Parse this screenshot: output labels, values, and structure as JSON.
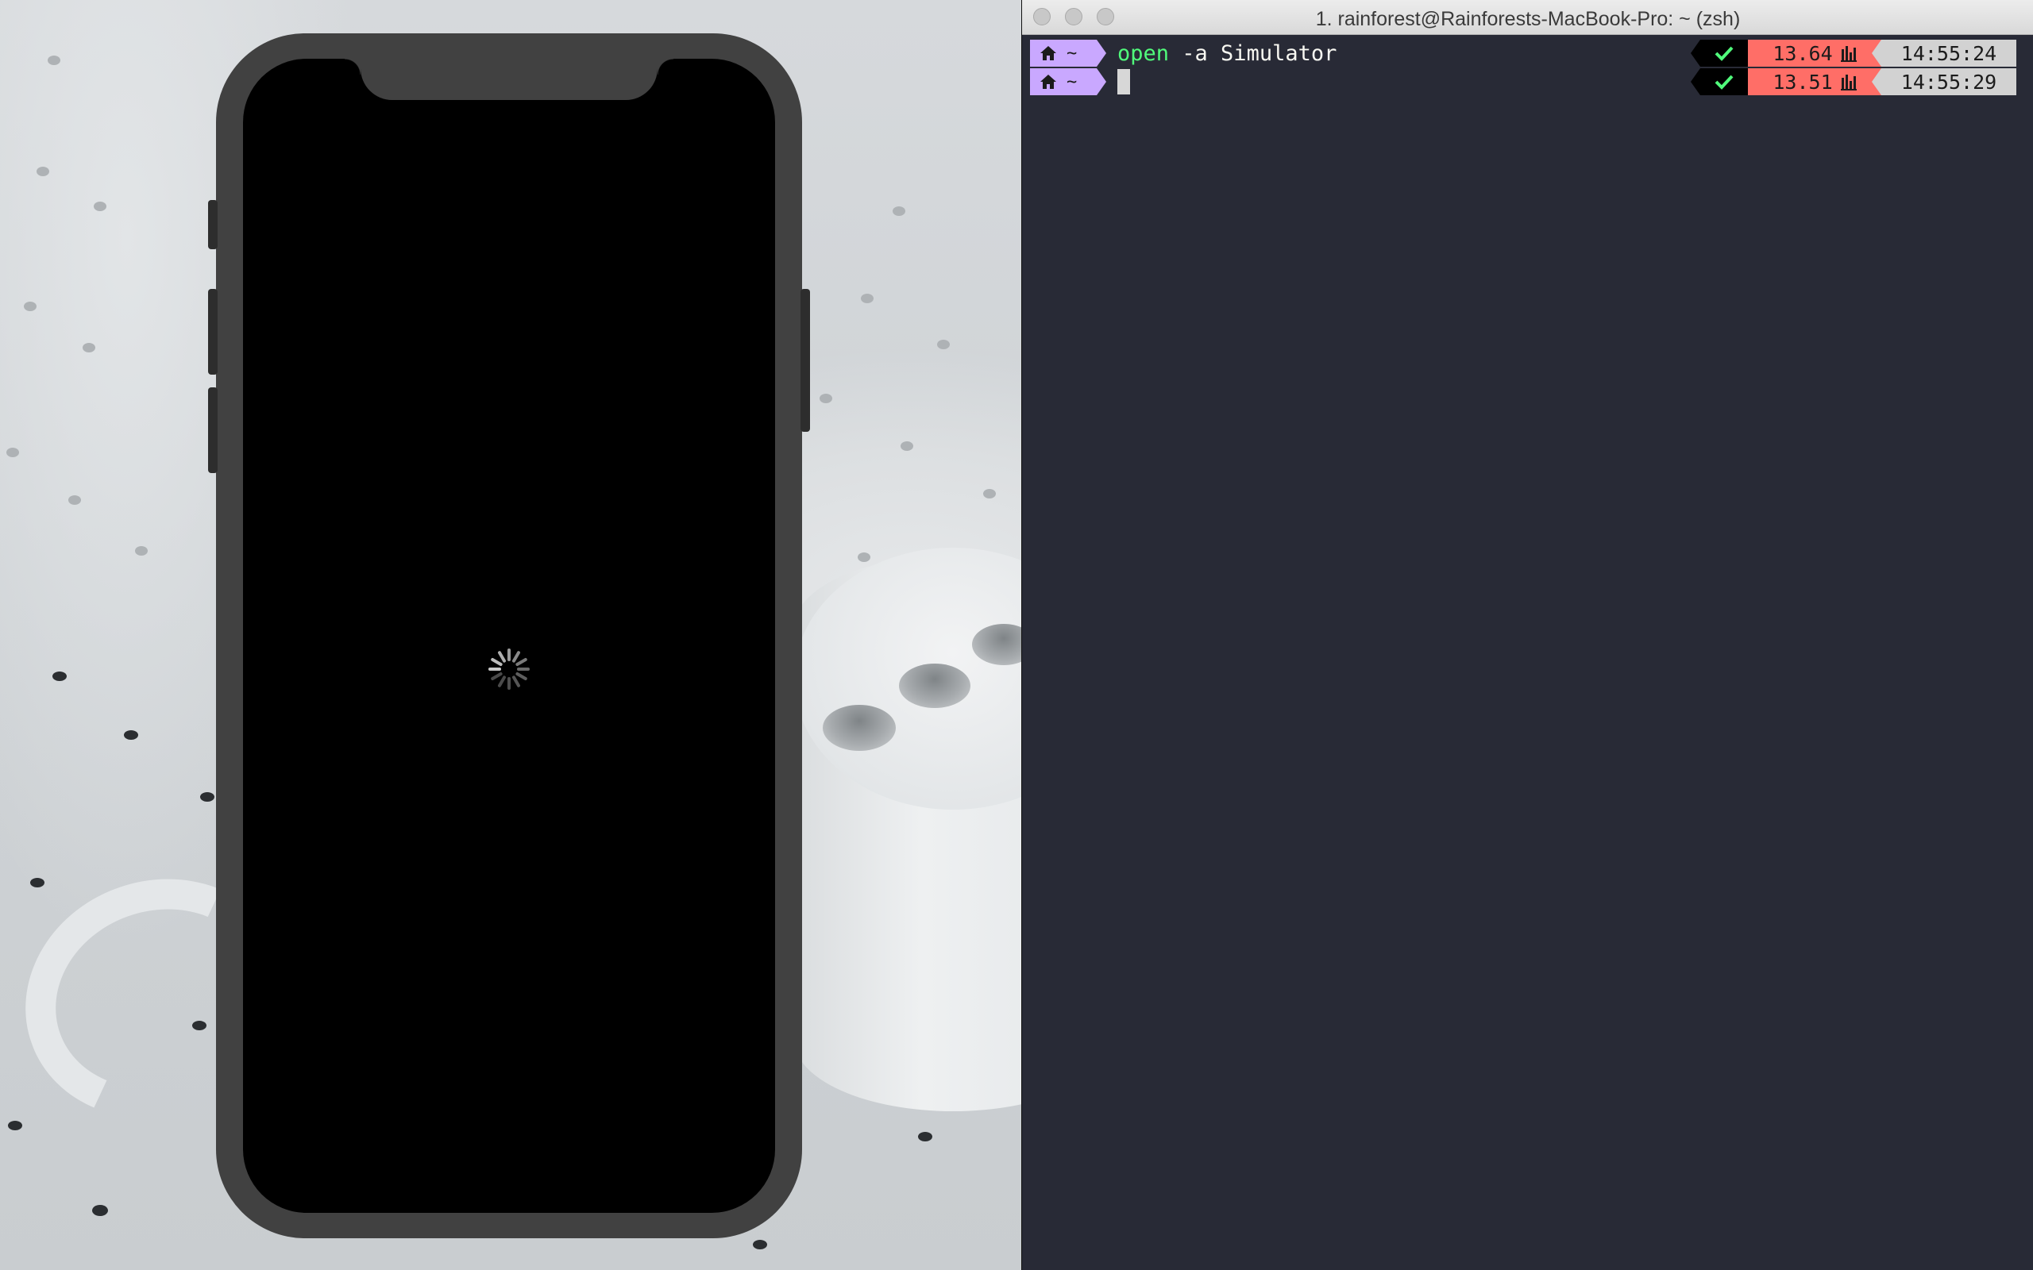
{
  "terminal": {
    "title": "1. rainforest@Rainforests-MacBook-Pro: ~ (zsh)",
    "background_color": "#282a36",
    "lines": [
      {
        "dir": "~",
        "home_icon": "home-icon",
        "command_keyword": "open",
        "command_args": " -a Simulator",
        "status_icon": "checkmark-icon",
        "load": "13.64",
        "load_icon": "bar-chart-icon",
        "time": "14:55:24"
      },
      {
        "dir": "~",
        "home_icon": "home-icon",
        "command_keyword": "",
        "command_args": "",
        "status_icon": "checkmark-icon",
        "load": "13.51",
        "load_icon": "bar-chart-icon",
        "time": "14:55:29"
      }
    ],
    "colors": {
      "prompt_segment": "#c9a8ff",
      "command_keyword": "#50fa7b",
      "status_ok": "#50fa7b",
      "load_segment": "#ff6e67",
      "time_segment": "#d2d2d2"
    }
  },
  "simulator": {
    "device": "iPhone",
    "screen_state": "loading",
    "spinner_icon": "activity-spinner-icon",
    "bezel_color": "#414141",
    "screen_color": "#000000"
  }
}
